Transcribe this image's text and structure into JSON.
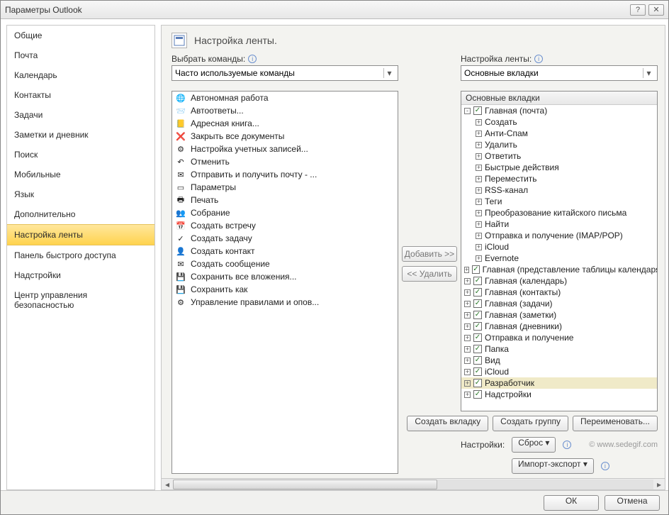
{
  "window_title": "Параметры Outlook",
  "titlebar_help": "?",
  "titlebar_close": "✕",
  "sidebar": {
    "items": [
      "Общие",
      "Почта",
      "Календарь",
      "Контакты",
      "Задачи",
      "Заметки и дневник",
      "Поиск",
      "Мобильные",
      "Язык",
      "Дополнительно",
      "Настройка ленты",
      "Панель быстрого доступа",
      "Надстройки",
      "Центр управления безопасностью"
    ],
    "selected_index": 10
  },
  "header": {
    "title": "Настройка ленты."
  },
  "left": {
    "label": "Выбрать команды:",
    "select_value": "Часто используемые команды",
    "commands": [
      {
        "icon": "🌐",
        "text": "Автономная работа"
      },
      {
        "icon": "📨",
        "text": "Автоответы..."
      },
      {
        "icon": "📒",
        "text": "Адресная книга..."
      },
      {
        "icon": "❌",
        "text": "Закрыть все документы"
      },
      {
        "icon": "⚙",
        "text": "Настройка учетных записей..."
      },
      {
        "icon": "↶",
        "text": "Отменить"
      },
      {
        "icon": "✉",
        "text": "Отправить и получить почту - ..."
      },
      {
        "icon": "▭",
        "text": "Параметры"
      },
      {
        "icon": "🖶",
        "text": "Печать"
      },
      {
        "icon": "👥",
        "text": "Собрание"
      },
      {
        "icon": "📅",
        "text": "Создать встречу"
      },
      {
        "icon": "✓",
        "text": "Создать задачу"
      },
      {
        "icon": "👤",
        "text": "Создать контакт"
      },
      {
        "icon": "✉",
        "text": "Создать сообщение"
      },
      {
        "icon": "💾",
        "text": "Сохранить все вложения..."
      },
      {
        "icon": "💾",
        "text": "Сохранить как"
      },
      {
        "icon": "⚙",
        "text": "Управление правилами и опов..."
      }
    ]
  },
  "mid": {
    "add": "Добавить >>",
    "remove": "<< Удалить"
  },
  "right": {
    "label": "Настройка ленты:",
    "select_value": "Основные вкладки",
    "tree_header": "Основные вкладки",
    "root": {
      "expander": "-",
      "checked": true,
      "label": "Главная (почта)",
      "children": [
        "Создать",
        "Анти-Спам",
        "Удалить",
        "Ответить",
        "Быстрые действия",
        "Переместить",
        "RSS-канал",
        "Теги",
        "Преобразование китайского письма",
        "Найти",
        "Отправка и получение (IMAP/POP)",
        "iCloud",
        "Evernote"
      ]
    },
    "siblings": [
      {
        "label": "Главная (представление таблицы календаря)"
      },
      {
        "label": "Главная (календарь)"
      },
      {
        "label": "Главная (контакты)"
      },
      {
        "label": "Главная (задачи)"
      },
      {
        "label": "Главная (заметки)"
      },
      {
        "label": "Главная (дневники)"
      },
      {
        "label": "Отправка и получение"
      },
      {
        "label": "Папка"
      },
      {
        "label": "Вид"
      },
      {
        "label": "iCloud"
      },
      {
        "label": "Разработчик",
        "highlight": true
      },
      {
        "label": "Надстройки"
      }
    ],
    "buttons": {
      "new_tab": "Создать вкладку",
      "new_group": "Создать группу",
      "rename": "Переименовать..."
    },
    "settings_label": "Настройки:",
    "reset": "Сброс ▾",
    "import": "Импорт-экспорт ▾",
    "watermark": "© www.sedegif.com"
  },
  "footer": {
    "ok": "ОК",
    "cancel": "Отмена"
  }
}
